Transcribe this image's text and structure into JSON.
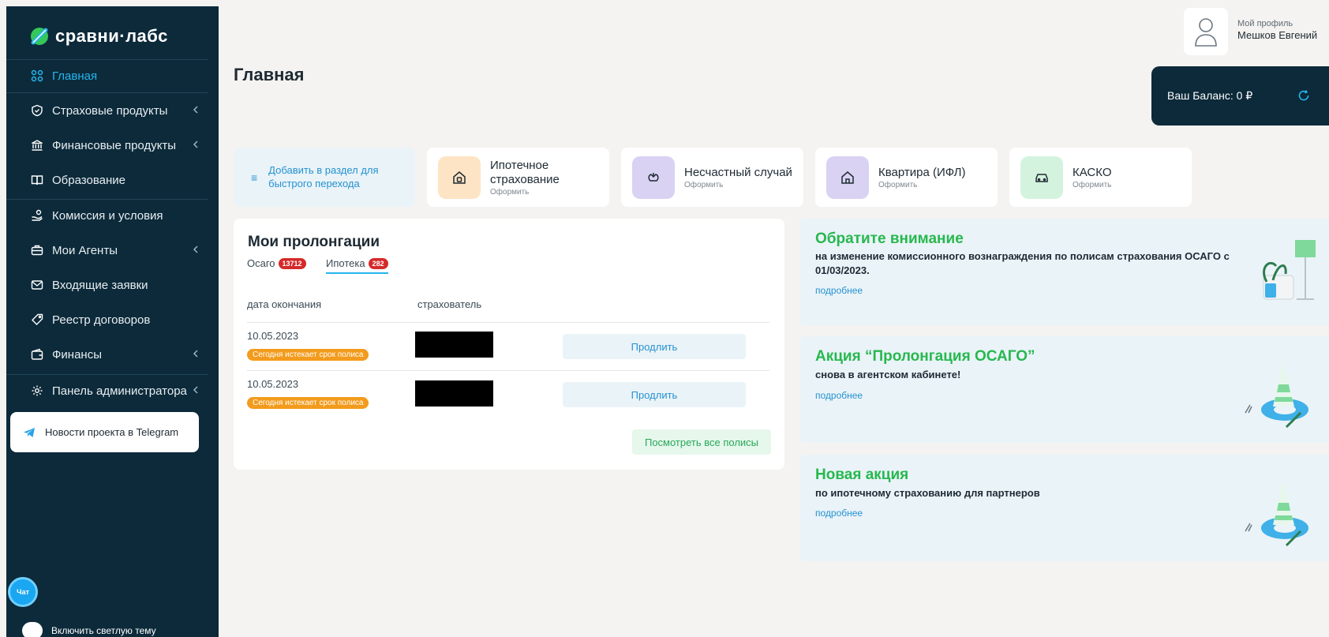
{
  "app": {
    "logo_text": "сравни·лабс"
  },
  "sidebar": {
    "items": [
      {
        "label": "Главная",
        "icon": "grid-icon",
        "active": true,
        "has_submenu": false
      },
      {
        "label": "Страховые продукты",
        "icon": "shield-icon",
        "active": false,
        "has_submenu": true
      },
      {
        "label": "Финансовые продукты",
        "icon": "bank-icon",
        "active": false,
        "has_submenu": true
      },
      {
        "label": "Образование",
        "icon": "book-icon",
        "active": false,
        "has_submenu": false
      },
      {
        "label": "Комиссия и условия",
        "icon": "hand-coins-icon",
        "active": false,
        "has_submenu": false
      },
      {
        "label": "Мои Агенты",
        "icon": "briefcase-icon",
        "active": false,
        "has_submenu": true
      },
      {
        "label": "Входящие заявки",
        "icon": "mail-icon",
        "active": false,
        "has_submenu": false
      },
      {
        "label": "Реестр договоров",
        "icon": "tag-icon",
        "active": false,
        "has_submenu": false
      },
      {
        "label": "Финансы",
        "icon": "wallet-icon",
        "active": false,
        "has_submenu": true
      },
      {
        "label": "Панель администратора",
        "icon": "gear-icon",
        "active": false,
        "has_submenu": true
      }
    ],
    "telegram_label": "Новости проекта в Telegram",
    "chat_label": "Чат",
    "theme_toggle_label": "Включить светлую тему"
  },
  "header": {
    "title": "Главная",
    "profile_sub": "Мой профиль",
    "profile_name": "Мешков Евгений",
    "balance_label": "Ваш Баланс: 0 ₽"
  },
  "quick": {
    "add_label": "Добавить в раздел для быстрого перехода",
    "products": [
      {
        "title": "Ипотечное страхование",
        "sub": "Оформить",
        "icon": "house-icon",
        "color": "#fde4c4"
      },
      {
        "title": "Несчастный случай",
        "sub": "Оформить",
        "icon": "bandage-icon",
        "color": "#d9d2f3"
      },
      {
        "title": "Квартира (ИФЛ)",
        "sub": "Оформить",
        "icon": "home-icon",
        "color": "#d9d2f3"
      },
      {
        "title": "КАСКО",
        "sub": "Оформить",
        "icon": "car-icon",
        "color": "#d4f3df"
      }
    ]
  },
  "prolongations": {
    "title": "Мои пролонгации",
    "tabs": [
      {
        "label": "Осаго",
        "count": "13712",
        "active": false
      },
      {
        "label": "Ипотека",
        "count": "282",
        "active": true
      }
    ],
    "columns": [
      "дата окончания",
      "страхователь"
    ],
    "rows": [
      {
        "date": "10.05.2023",
        "tag": "Сегодня истекает срок полиса",
        "action": "Продлить"
      },
      {
        "date": "10.05.2023",
        "tag": "Сегодня истекает срок полиса",
        "action": "Продлить"
      }
    ],
    "view_all": "Посмотреть все полисы"
  },
  "news": [
    {
      "title": "Обратите внимание",
      "text": "на изменение комиссионного вознаграждения по полисам страхования ОСАГО с 01/03/2023.",
      "more": "подробнее"
    },
    {
      "title": "Акция “Пролонгация ОСАГО”",
      "text": "снова в агентском кабинете!",
      "more": "подробнее"
    },
    {
      "title": "Новая акция",
      "text": "по ипотечному страхованию для партнеров",
      "more": "подробнее"
    }
  ],
  "colors": {
    "sidebar_bg": "#0c2a3a",
    "accent_blue": "#25b5ee",
    "accent_green": "#27b84e",
    "badge_red": "#d52a2a",
    "tag_orange": "#f39b1c"
  }
}
